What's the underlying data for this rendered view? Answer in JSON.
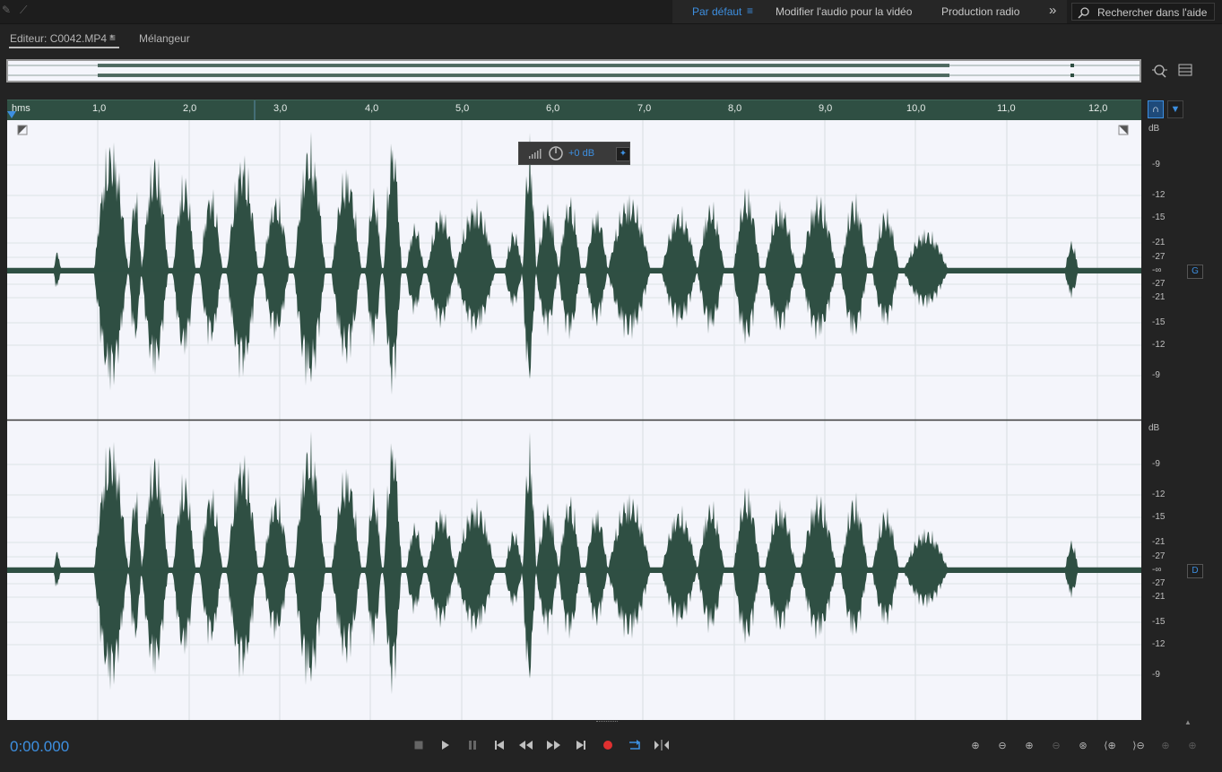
{
  "header": {
    "workspaces": [
      {
        "label": "Par défaut",
        "active": true
      },
      {
        "label": "Modifier l'audio pour la vidéo",
        "active": false
      },
      {
        "label": "Production radio",
        "active": false
      }
    ],
    "more_icon": "»",
    "search_placeholder": "Rechercher dans l'aide"
  },
  "tabs": {
    "editor_label": "Editeur: C0042.MP4 *",
    "mixer_label": "Mélangeur"
  },
  "ruler": {
    "ticks": [
      "hms",
      "1,0",
      "2,0",
      "3,0",
      "4,0",
      "5,0",
      "6,0",
      "7,0",
      "8,0",
      "9,0",
      "10,0",
      "11,0",
      "12,0"
    ]
  },
  "hud": {
    "gain_label": "+0 dB"
  },
  "db_scale": {
    "unit": "dB",
    "upper": [
      "-9",
      "-12",
      "-15",
      "-21",
      "-27",
      "-∞",
      "-27",
      "-21",
      "-15",
      "-12",
      "-9"
    ]
  },
  "channels": {
    "left": "G",
    "right": "D"
  },
  "transport": {
    "time": "0:00.000"
  },
  "colors": {
    "accent": "#3d8fe0",
    "waveform": "#2f4f43",
    "wave_bg": "#f4f5fb",
    "record": "#e03030"
  }
}
